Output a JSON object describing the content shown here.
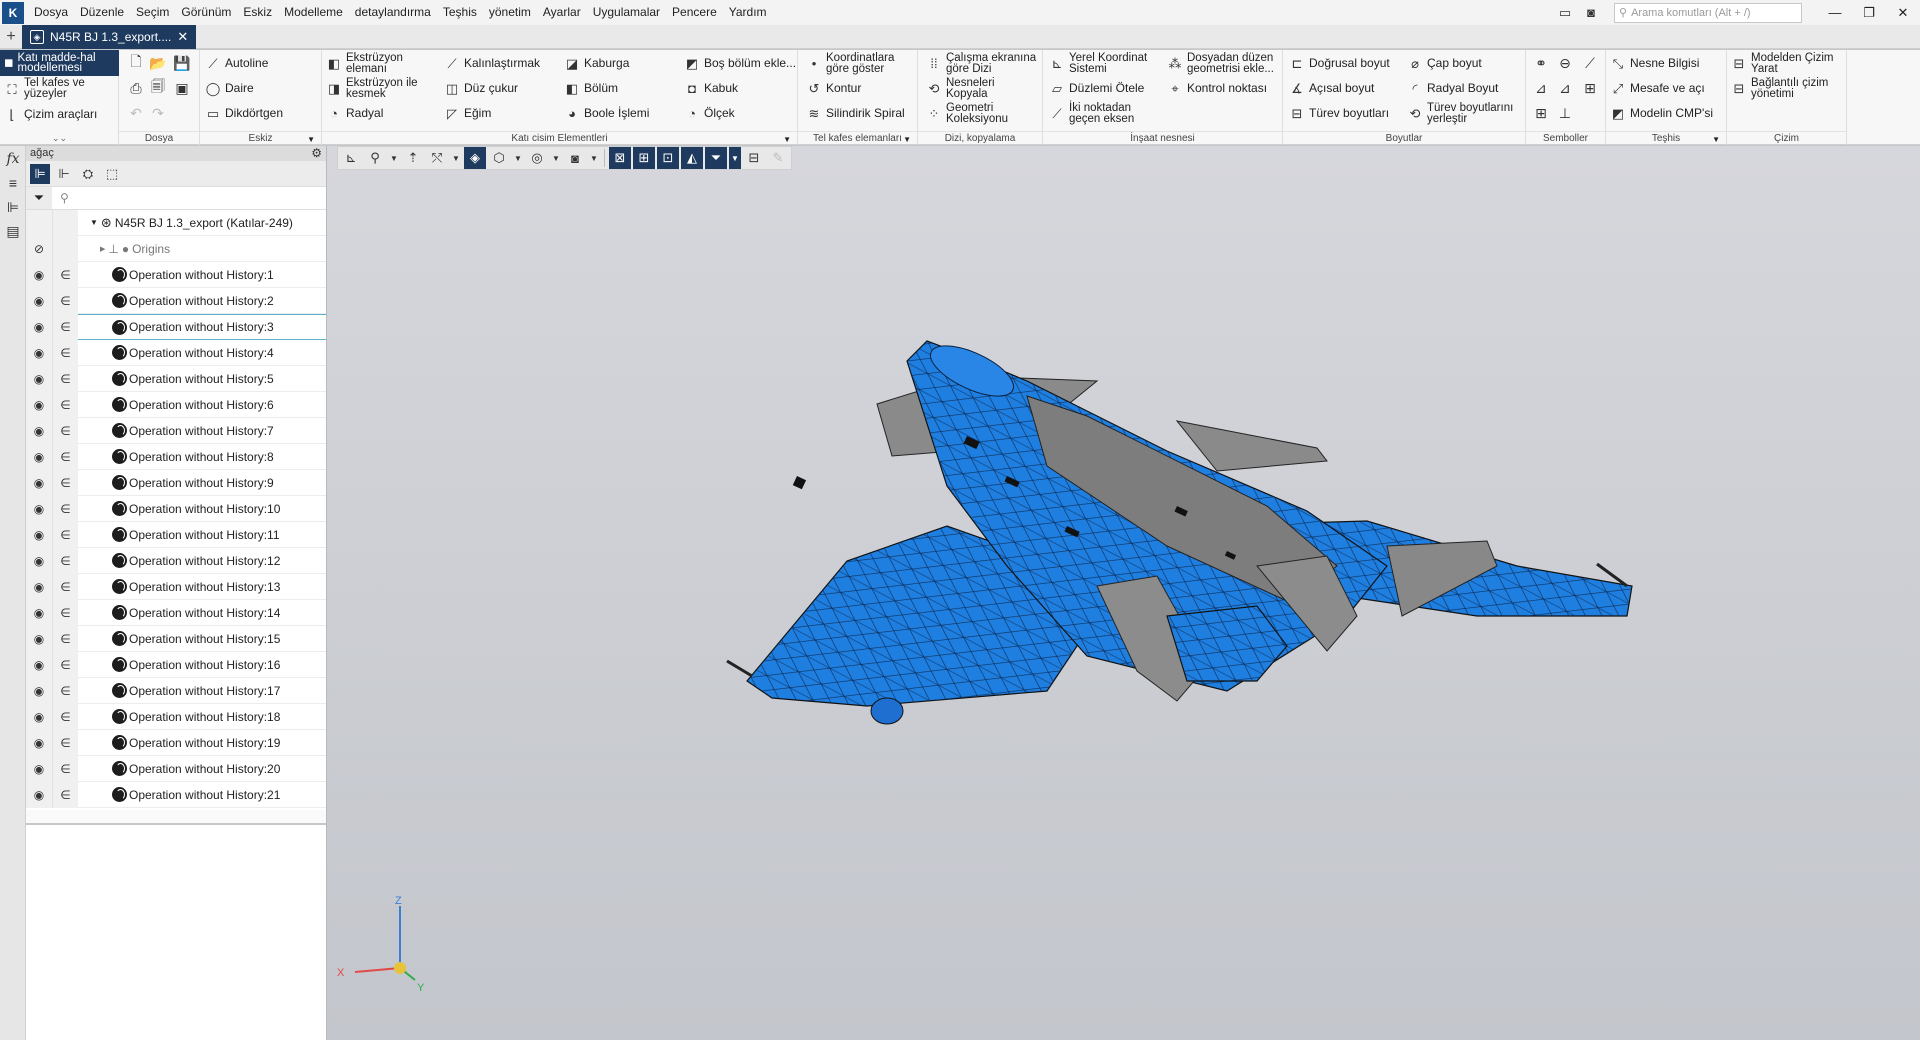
{
  "menu": [
    "Dosya",
    "Düzenle",
    "Seçim",
    "Görünüm",
    "Eskiz",
    "Modelleme",
    "detaylandırma",
    "Teşhis",
    "yönetim",
    "Ayarlar",
    "Uygulamalar",
    "Pencere",
    "Yardım"
  ],
  "search": {
    "placeholder": "Arama komutları (Alt + /)"
  },
  "tab": {
    "title": "N45R BJ 1.3_export...."
  },
  "ribbon": {
    "mode_solid": "Katı madde-hal modellemesi",
    "mode_wire": "Tel kafes ve yüzeyler",
    "mode_draw": "Çizim araçları",
    "groups": {
      "dosya": "Dosya",
      "eskiz": "Eskiz",
      "kati": "Katı cisim Elementleri",
      "tel": "Tel kafes elemanları",
      "dizi": "Dizi, kopyalama",
      "insaat": "İnşaat nesnesi",
      "boyutlar": "Boyutlar",
      "semboller": "Semboller",
      "teshis": "Teşhis",
      "cizim": "Çizim"
    },
    "eskiz": {
      "autoline": "Autoline",
      "daire": "Daire",
      "dikdortgen": "Dikdörtgen"
    },
    "kati": {
      "ekstruzyon1": "Ekstrüzyon",
      "ekstruzyon2": "elemanı",
      "ekskes1": "Ekstrüzyon ile",
      "ekskes2": "kesmek",
      "radyal": "Radyal",
      "kalinlastirmak": "Kalınlaştırmak",
      "duzcukur": "Düz çukur",
      "egim": "Eğim",
      "kaburga": "Kaburga",
      "bolum": "Bölüm",
      "boole": "Boole İşlemi",
      "bosbolum": "Boş bölüm ekle...",
      "kabuk": "Kabuk",
      "olcek": "Ölçek"
    },
    "tel": {
      "koord1": "Koordinatlara",
      "koord2": "göre göster",
      "kontur": "Kontur",
      "spiral": "Silindirik Spiral"
    },
    "dizi": {
      "calisma1": "Çalışma ekranına",
      "calisma2": "göre Dizi",
      "nesneleri1": "Nesneleri",
      "nesneleri2": "Kopyala",
      "geometri1": "Geometri",
      "geometri2": "Koleksiyonu"
    },
    "insaat": {
      "yerel1": "Yerel Koordinat",
      "yerel2": "Sistemi",
      "duzlem": "Düzlemi Ötele",
      "iki1": "İki noktadan",
      "iki2": "geçen eksen",
      "dosyadan1": "Dosyadan düzen",
      "dosyadan2": "geometrisi ekle...",
      "kontrol": "Kontrol noktası"
    },
    "boyutlar": {
      "dogrusal": "Doğrusal boyut",
      "acisal": "Açısal boyut",
      "turev": "Türev boyutları",
      "cap": "Çap boyut",
      "radyal": "Radyal Boyut",
      "turevyer1": "Türev boyutlarını",
      "turevyer2": "yerleştir"
    },
    "teshis": {
      "nesne": "Nesne Bilgisi",
      "mesafe": "Mesafe ve açı",
      "cmp": "Modelin CMP'si"
    },
    "cizim": {
      "yarat1": "Modelden Çizim",
      "yarat2": "Yarat",
      "bagli1": "Bağlantılı çizim",
      "bagli2": "yönetimi"
    }
  },
  "panel": {
    "title": "ağaç",
    "root": "N45R BJ 1.3_export (Katılar-249)",
    "origins": "Origins",
    "items": [
      "Operation without History:1",
      "Operation without History:2",
      "Operation without History:3",
      "Operation without History:4",
      "Operation without History:5",
      "Operation without History:6",
      "Operation without History:7",
      "Operation without History:8",
      "Operation without History:9",
      "Operation without History:10",
      "Operation without History:11",
      "Operation without History:12",
      "Operation without History:13",
      "Operation without History:14",
      "Operation without History:15",
      "Operation without History:16",
      "Operation without History:17",
      "Operation without History:18",
      "Operation without History:19",
      "Operation without History:20",
      "Operation without History:21"
    ]
  },
  "axes": {
    "x": "X",
    "y": "Y",
    "z": "Z"
  },
  "colors": {
    "accent": "#1f3a5f",
    "model_blue": "#1f7fe0",
    "model_grey": "#8a8a8a"
  }
}
